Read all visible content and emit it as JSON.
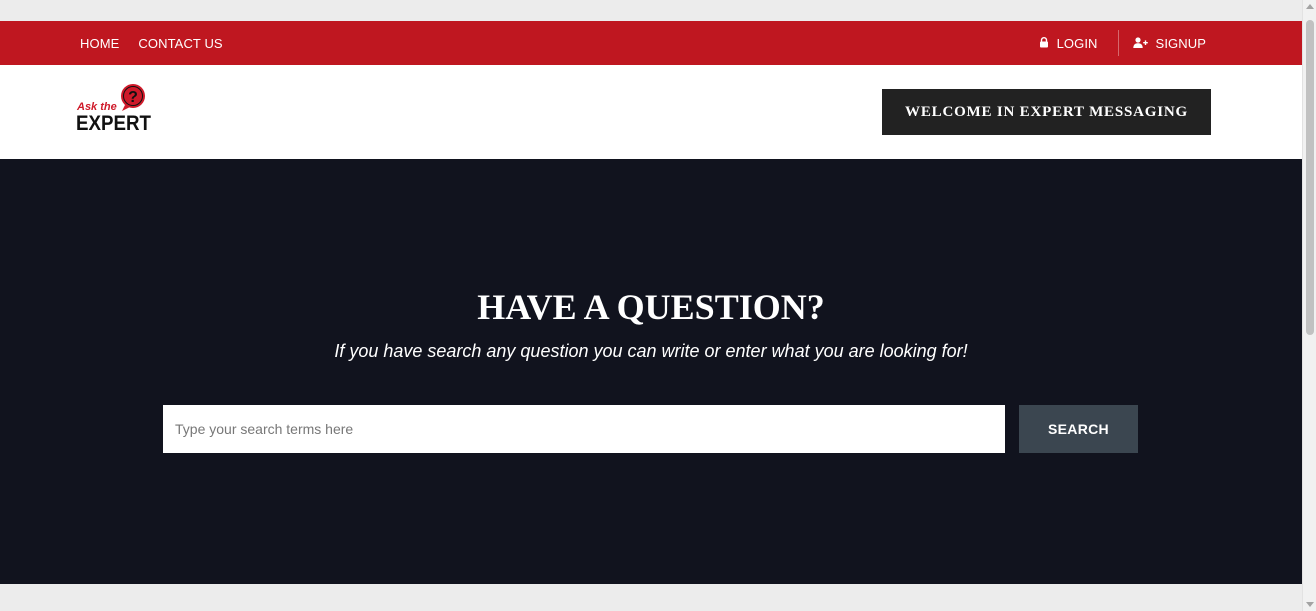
{
  "topbar": {
    "nav": [
      {
        "label": "HOME"
      },
      {
        "label": "CONTACT US"
      }
    ],
    "login_label": "LOGIN",
    "signup_label": "SIGNUP",
    "background_color": "#bf1720"
  },
  "header": {
    "logo": {
      "line1": "Ask the",
      "line2": "EXPERT",
      "badge": "?"
    },
    "welcome_label": "WELCOME IN EXPERT MESSAGING"
  },
  "hero": {
    "title": "HAVE A QUESTION?",
    "subtitle": "If you have search any question you can write or enter what you are looking for!",
    "background_color": "#11131e"
  },
  "search": {
    "placeholder": "Type your search terms here",
    "value": "",
    "button_label": "SEARCH"
  },
  "icons": {
    "login": "lock-icon",
    "signup": "user-plus-icon"
  }
}
